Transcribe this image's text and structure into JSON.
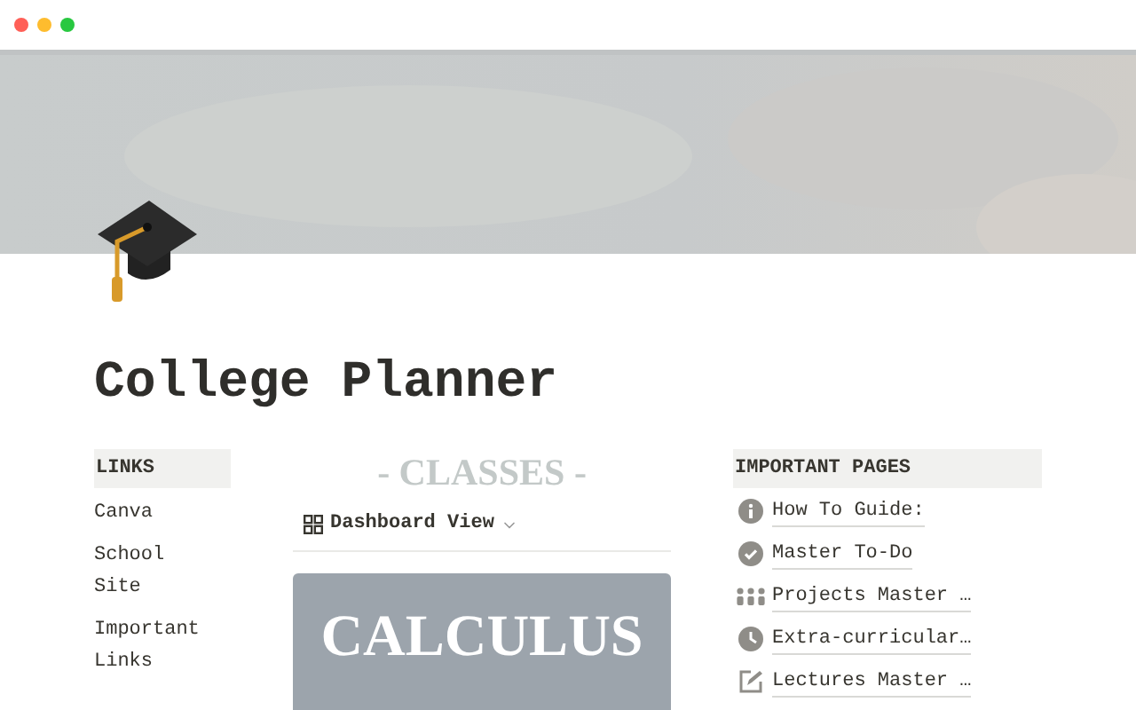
{
  "window": {
    "controls": [
      {
        "color": "#ff5f57"
      },
      {
        "color": "#febc2e"
      },
      {
        "color": "#28c840"
      }
    ]
  },
  "page": {
    "title": "College Planner"
  },
  "links": {
    "heading": "LINKS",
    "items": [
      "Canva",
      "School Site",
      "Important Links"
    ]
  },
  "classes": {
    "heading": "- CLASSES -",
    "view": "Dashboard View",
    "cards": [
      {
        "title": "CALCULUS"
      }
    ]
  },
  "important_pages": {
    "heading": "IMPORTANT PAGES",
    "items": [
      {
        "kind": "info",
        "label": "How To Guide:"
      },
      {
        "kind": "check",
        "label": "Master To-Do"
      },
      {
        "kind": "people",
        "label": "Projects Master …"
      },
      {
        "kind": "clock",
        "label": "Extra-curricular…"
      },
      {
        "kind": "edit",
        "label": "Lectures Master …"
      }
    ]
  }
}
